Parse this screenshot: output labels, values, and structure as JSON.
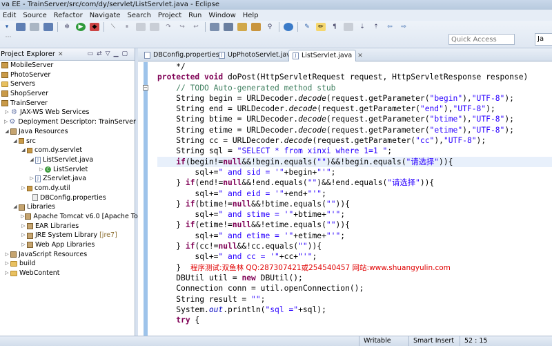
{
  "window": {
    "title": "va EE - TrainServer/src/com/dy/servlet/ListServlet.java - Eclipse"
  },
  "menu": [
    "Edit",
    "Source",
    "Refactor",
    "Navigate",
    "Search",
    "Project",
    "Run",
    "Window",
    "Help"
  ],
  "toolbar": {
    "quick_access_placeholder": "Quick Access",
    "perspective_label": "Ja"
  },
  "project_explorer": {
    "title": "Project Explorer",
    "items": [
      {
        "label": "MobileServer",
        "icon": "project-icon"
      },
      {
        "label": "PhotoServer",
        "icon": "project-icon"
      },
      {
        "label": "Servers",
        "icon": "folder-icon"
      },
      {
        "label": "ShopServer",
        "icon": "project-icon"
      },
      {
        "label": "TrainServer",
        "icon": "project-icon"
      },
      {
        "label": "JAX-WS Web Services",
        "icon": "webservice-icon"
      },
      {
        "label": "Deployment Descriptor: TrainServer",
        "icon": "descriptor-icon"
      },
      {
        "label": "Java Resources",
        "icon": "java-resources-icon"
      },
      {
        "label": "src",
        "icon": "source-folder-icon"
      },
      {
        "label": "com.dy.servlet",
        "icon": "package-icon"
      },
      {
        "label": "ListServlet.java",
        "icon": "java-file-icon"
      },
      {
        "label": "ListServlet",
        "icon": "class-icon"
      },
      {
        "label": "ZServlet.java",
        "icon": "java-file-icon"
      },
      {
        "label": "com.dy.util",
        "icon": "package-icon"
      },
      {
        "label": "DBConfig.properties",
        "icon": "properties-file-icon"
      },
      {
        "label": "Libraries",
        "icon": "library-icon"
      },
      {
        "label": "Apache Tomcat v6.0 [Apache Tom",
        "icon": "library-icon"
      },
      {
        "label": "EAR Libraries",
        "icon": "library-icon"
      },
      {
        "label": "JRE System Library",
        "decoration": "[jre7]",
        "icon": "library-icon"
      },
      {
        "label": "Web App Libraries",
        "icon": "library-icon"
      },
      {
        "label": "JavaScript Resources",
        "icon": "javascript-resources-icon"
      },
      {
        "label": "build",
        "icon": "folder-icon"
      },
      {
        "label": "WebContent",
        "icon": "folder-icon"
      }
    ]
  },
  "editor": {
    "tabs": [
      {
        "label": "DBConfig.properties",
        "active": false
      },
      {
        "label": "UpPhotoServlet.java",
        "active": false
      },
      {
        "label": "ListServlet.java",
        "active": true
      }
    ],
    "code": {
      "l1": "*/",
      "l2a": "protected void",
      "l2b": " doPost(HttpServletRequest request, HttpServletResponse response)",
      "l3": "// TODO Auto-generated method stub",
      "begin_decl": "String begin = URLDecoder.",
      "decode": "decode",
      "begin_arg": "(request.getParameter(",
      "begin_s": "\"begin\"",
      "enc": "\"UTF-8\"",
      "end_decl": "String end = URLDecoder.",
      "end_s": "\"end\"",
      "btime_decl": "String btime = URLDecoder.",
      "btime_s": "\"btime\"",
      "etime_decl": "String etime = URLDecoder.",
      "etime_s": "\"etime\"",
      "cc_decl": "String cc = URLDecoder.",
      "cc_s": "\"cc\"",
      "sql_decl": "String sql = ",
      "sql_s": "\"SELECT * from xinxi where 1=1 \"",
      "if1a": "if",
      "if1b": "(begin!=",
      "nul": "null",
      "if1c": "&&!begin.equals(",
      "empty": "\"\"",
      "if1d": ")&&!begin.equals(",
      "choose": "\"请选择\"",
      "if1e": ")){",
      "sql_plus": "sql+=",
      "sid_s": "\" and sid = '\"",
      "plus_begin": "+begin+",
      "quote_end": "\"'\"",
      "else_if": "} ",
      "if2b": "(end!=",
      "if2c": "&&!end.equals(",
      "if2d": ")&&!end.equals(",
      "eid_s": "\" and eid = '\"",
      "plus_end": "+end+",
      "if3b": "(btime!=",
      "if3c": "&&!btime.equals(",
      "close_paren": ")){",
      "stime_s": "\" and stime = '\"",
      "plus_btime": "+btime+",
      "if4b": "(etime!=",
      "if4c": "&&!etime.equals(",
      "etime_cond_s": "\" and etime = '\"",
      "plus_etime": "+etime+",
      "if5b": "(cc!=",
      "if5c": "&&!cc.equals(",
      "cc_cond_s": "\" and cc = '\"",
      "plus_cc": "+cc+",
      "brace_close": "}",
      "watermark": "程序测试:双鱼林 QQ:287307421或254540457 网站:www.shuangyulin.com",
      "dbutil_a": "DBUtil util = ",
      "kw_new": "new",
      "dbutil_b": " DBUtil();",
      "conn": "Connection conn = util.openConnection();",
      "result_a": "String result = ",
      "result_b": ";",
      "print_a": "System.",
      "out": "out",
      "print_b": ".println(",
      "print_s": "\"sql =\"",
      "print_c": "+sql);",
      "kw_try": "try",
      "try_b": " {"
    }
  },
  "statusbar": {
    "writable": "Writable",
    "insert_mode": "Smart Insert",
    "position": "52 : 15"
  }
}
